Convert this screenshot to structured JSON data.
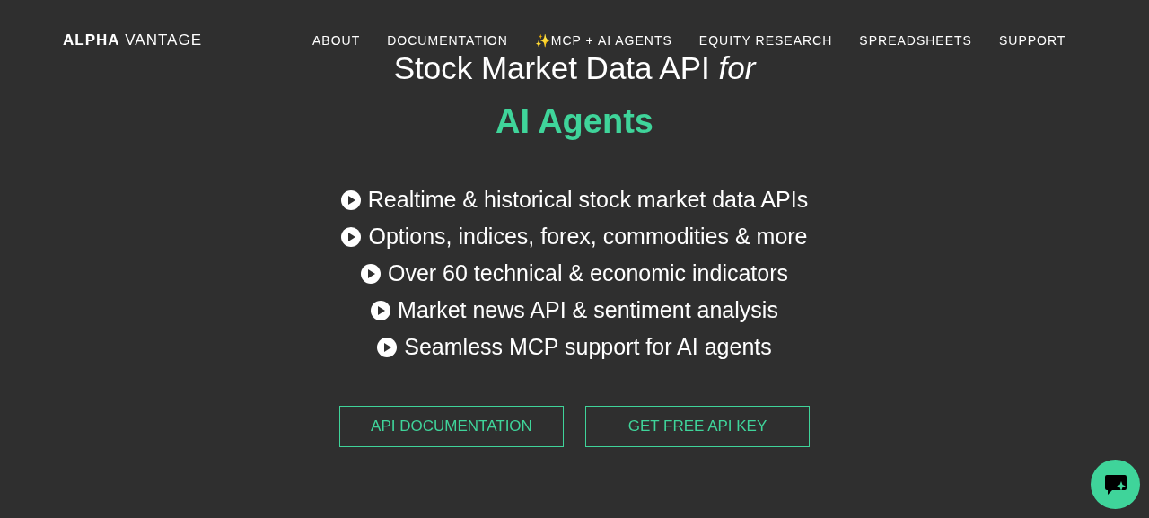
{
  "header": {
    "logo": "**ALPHA** VANTAGE",
    "nav": [
      "ABOUT",
      "DOCUMENTATION",
      "✨MCP + AI AGENTS",
      "EQUITY RESEARCH",
      "SPREADSHEETS",
      "SUPPORT"
    ]
  },
  "hero": {
    "title": "Stock Market Data API *for*",
    "subtitle": "AI Agents",
    "features": [
      "Realtime & historical stock market data APIs",
      "Options, indices, forex, commodities & more",
      "Over 60 technical & economic indicators",
      "Market news API & sentiment analysis",
      "Seamless MCP support for AI agents"
    ],
    "buttons": [
      "API DOCUMENTATION",
      "GET FREE API KEY"
    ]
  }
}
